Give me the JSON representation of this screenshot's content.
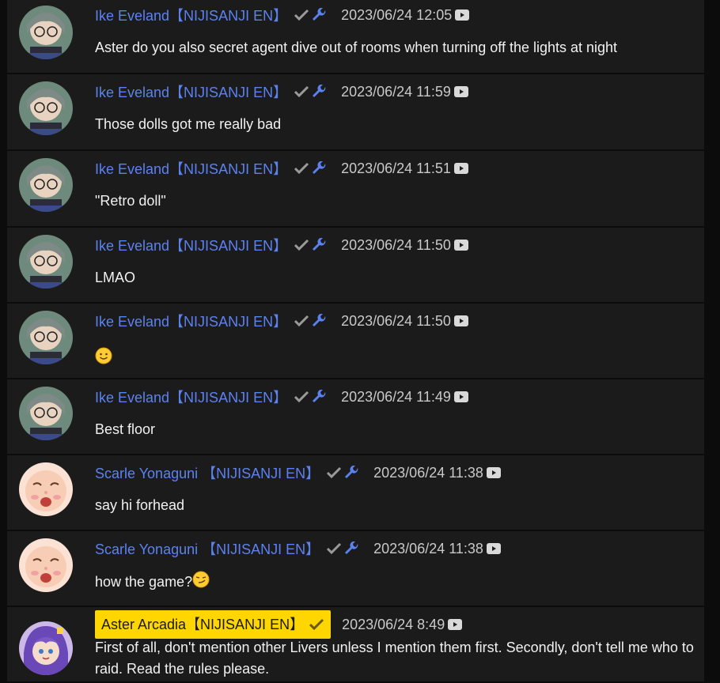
{
  "messages": [
    {
      "author": "Ike Eveland【NIJISANJI EN】",
      "timestamp": "2023/06/24 12:05",
      "text": "Aster do you also secret agent dive out of rooms when turning off the lights at night",
      "avatar": "ike"
    },
    {
      "author": "Ike Eveland【NIJISANJI EN】",
      "timestamp": "2023/06/24 11:59",
      "text": "Those dolls got me really bad",
      "avatar": "ike"
    },
    {
      "author": "Ike Eveland【NIJISANJI EN】",
      "timestamp": "2023/06/24 11:51",
      "text": "\"Retro doll\"",
      "avatar": "ike"
    },
    {
      "author": "Ike Eveland【NIJISANJI EN】",
      "timestamp": "2023/06/24 11:50",
      "text": "LMAO",
      "avatar": "ike"
    },
    {
      "author": "Ike Eveland【NIJISANJI EN】",
      "timestamp": "2023/06/24 11:50",
      "text": "",
      "emoji": "slightly-smiling-face",
      "avatar": "ike"
    },
    {
      "author": "Ike Eveland【NIJISANJI EN】",
      "timestamp": "2023/06/24 11:49",
      "text": "Best floor",
      "avatar": "ike"
    },
    {
      "author": "Scarle Yonaguni 【NIJISANJI EN】",
      "timestamp": "2023/06/24 11:38",
      "text": "say hi forhead",
      "avatar": "scarle"
    },
    {
      "author": "Scarle Yonaguni 【NIJISANJI EN】",
      "timestamp": "2023/06/24 11:38",
      "text": "how the game?",
      "emoji": "smirking-face",
      "avatar": "scarle"
    },
    {
      "author": "Aster Arcadia【NIJISANJI EN】",
      "timestamp": "2023/06/24 8:49",
      "text": "First of all, don't mention other Livers unless I mention them first. Secondly, don't tell me who to raid. Read the rules please.",
      "avatar": "aster",
      "owner": true
    }
  ],
  "colors": {
    "author": "#5b82f0",
    "owner_badge": "#ffd600",
    "background": "#0c0c0c",
    "card": "#1b1b1b"
  }
}
